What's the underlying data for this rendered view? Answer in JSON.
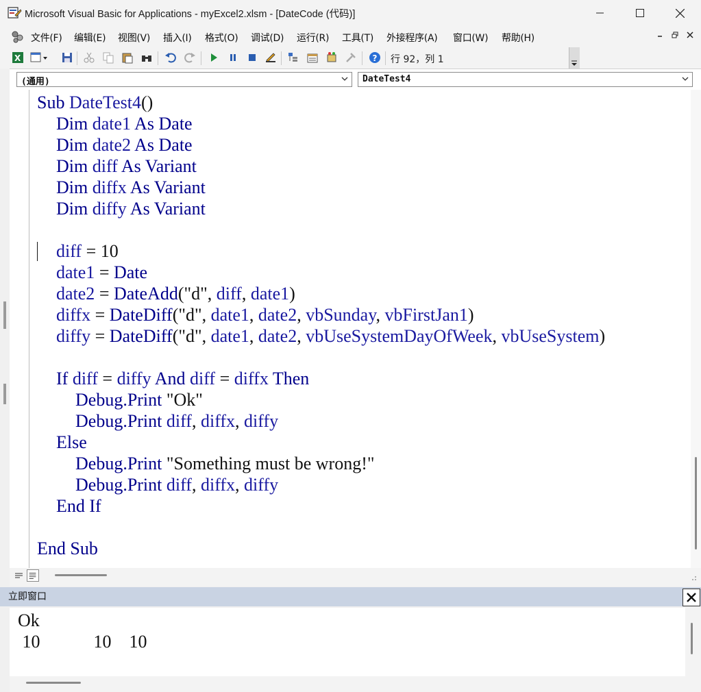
{
  "window": {
    "title": "Microsoft Visual Basic for Applications - myExcel2.xlsm - [DateCode (代码)]"
  },
  "menu": {
    "items": [
      {
        "label": "文件(F)"
      },
      {
        "label": "编辑(E)"
      },
      {
        "label": "视图(V)"
      },
      {
        "label": "插入(I)"
      },
      {
        "label": "格式(O)"
      },
      {
        "label": "调试(D)"
      },
      {
        "label": "运行(R)"
      },
      {
        "label": "工具(T)"
      },
      {
        "label": "外接程序(A)"
      },
      {
        "label": "窗口(W)"
      },
      {
        "label": "帮助(H)"
      }
    ]
  },
  "toolbar": {
    "cursor_position": "行 92，列 1",
    "icons": [
      "excel-icon",
      "insert-userform-icon",
      "save-icon",
      "cut-icon",
      "copy-icon",
      "paste-icon",
      "find-icon",
      "undo-icon",
      "redo-icon",
      "run-icon",
      "break-icon",
      "reset-icon",
      "design-mode-icon",
      "project-explorer-icon",
      "properties-icon",
      "object-browser-icon",
      "toolbox-icon",
      "help-icon"
    ]
  },
  "code_window": {
    "object_combo": "(通用)",
    "procedure_combo": "DateTest4",
    "lines": [
      {
        "indent": 0,
        "parts": [
          {
            "t": "Sub ",
            "c": "kw"
          },
          {
            "t": "DateTest4",
            "c": "id"
          },
          {
            "t": "()",
            "c": "tx"
          }
        ]
      },
      {
        "indent": 1,
        "parts": [
          {
            "t": "Dim ",
            "c": "kw"
          },
          {
            "t": "date1",
            "c": "id"
          },
          {
            "t": " As Date",
            "c": "kw"
          }
        ]
      },
      {
        "indent": 1,
        "parts": [
          {
            "t": "Dim ",
            "c": "kw"
          },
          {
            "t": "date2",
            "c": "id"
          },
          {
            "t": " As Date",
            "c": "kw"
          }
        ]
      },
      {
        "indent": 1,
        "parts": [
          {
            "t": "Dim ",
            "c": "kw"
          },
          {
            "t": "diff",
            "c": "id"
          },
          {
            "t": " As Variant",
            "c": "kw"
          }
        ]
      },
      {
        "indent": 1,
        "parts": [
          {
            "t": "Dim ",
            "c": "kw"
          },
          {
            "t": "diffx",
            "c": "id"
          },
          {
            "t": " As Variant",
            "c": "kw"
          }
        ]
      },
      {
        "indent": 1,
        "parts": [
          {
            "t": "Dim ",
            "c": "kw"
          },
          {
            "t": "diffy",
            "c": "id"
          },
          {
            "t": " As Variant",
            "c": "kw"
          }
        ]
      },
      {
        "indent": 0,
        "parts": []
      },
      {
        "indent": 1,
        "parts": [
          {
            "t": "diff",
            "c": "id"
          },
          {
            "t": " = 10",
            "c": "tx"
          }
        ]
      },
      {
        "indent": 1,
        "parts": [
          {
            "t": "date1",
            "c": "id"
          },
          {
            "t": " = ",
            "c": "tx"
          },
          {
            "t": "Date",
            "c": "kw"
          }
        ]
      },
      {
        "indent": 1,
        "parts": [
          {
            "t": "date2",
            "c": "id"
          },
          {
            "t": " = ",
            "c": "tx"
          },
          {
            "t": "DateAdd",
            "c": "kw"
          },
          {
            "t": "(\"d\", ",
            "c": "tx"
          },
          {
            "t": "diff",
            "c": "id"
          },
          {
            "t": ", ",
            "c": "tx"
          },
          {
            "t": "date1",
            "c": "id"
          },
          {
            "t": ")",
            "c": "tx"
          }
        ]
      },
      {
        "indent": 1,
        "parts": [
          {
            "t": "diffx",
            "c": "id"
          },
          {
            "t": " = ",
            "c": "tx"
          },
          {
            "t": "DateDiff",
            "c": "kw"
          },
          {
            "t": "(\"d\", ",
            "c": "tx"
          },
          {
            "t": "date1",
            "c": "id"
          },
          {
            "t": ", ",
            "c": "tx"
          },
          {
            "t": "date2",
            "c": "id"
          },
          {
            "t": ", ",
            "c": "tx"
          },
          {
            "t": "vbSunday",
            "c": "id"
          },
          {
            "t": ", ",
            "c": "tx"
          },
          {
            "t": "vbFirstJan1",
            "c": "id"
          },
          {
            "t": ")",
            "c": "tx"
          }
        ]
      },
      {
        "indent": 1,
        "parts": [
          {
            "t": "diffy",
            "c": "id"
          },
          {
            "t": " = ",
            "c": "tx"
          },
          {
            "t": "DateDiff",
            "c": "kw"
          },
          {
            "t": "(\"d\", ",
            "c": "tx"
          },
          {
            "t": "date1",
            "c": "id"
          },
          {
            "t": ", ",
            "c": "tx"
          },
          {
            "t": "date2",
            "c": "id"
          },
          {
            "t": ", ",
            "c": "tx"
          },
          {
            "t": "vbUseSystemDayOfWeek",
            "c": "id"
          },
          {
            "t": ", ",
            "c": "tx"
          },
          {
            "t": "vbUseSystem",
            "c": "id"
          },
          {
            "t": ")",
            "c": "tx"
          }
        ]
      },
      {
        "indent": 0,
        "parts": []
      },
      {
        "indent": 1,
        "parts": [
          {
            "t": "If ",
            "c": "kw"
          },
          {
            "t": "diff",
            "c": "id"
          },
          {
            "t": " = ",
            "c": "tx"
          },
          {
            "t": "diffy",
            "c": "id"
          },
          {
            "t": " And ",
            "c": "kw"
          },
          {
            "t": "diff",
            "c": "id"
          },
          {
            "t": " = ",
            "c": "tx"
          },
          {
            "t": "diffx",
            "c": "id"
          },
          {
            "t": " Then",
            "c": "kw"
          }
        ]
      },
      {
        "indent": 2,
        "parts": [
          {
            "t": "Debug.Print",
            "c": "kw"
          },
          {
            "t": " \"Ok\"",
            "c": "tx"
          }
        ]
      },
      {
        "indent": 2,
        "parts": [
          {
            "t": "Debug.Print",
            "c": "kw"
          },
          {
            "t": " ",
            "c": "tx"
          },
          {
            "t": "diff",
            "c": "id"
          },
          {
            "t": ", ",
            "c": "tx"
          },
          {
            "t": "diffx",
            "c": "id"
          },
          {
            "t": ", ",
            "c": "tx"
          },
          {
            "t": "diffy",
            "c": "id"
          }
        ]
      },
      {
        "indent": 1,
        "parts": [
          {
            "t": "Else",
            "c": "kw"
          }
        ]
      },
      {
        "indent": 2,
        "parts": [
          {
            "t": "Debug.Print",
            "c": "kw"
          },
          {
            "t": " \"Something must be wrong!\"",
            "c": "tx"
          }
        ]
      },
      {
        "indent": 2,
        "parts": [
          {
            "t": "Debug.Print",
            "c": "kw"
          },
          {
            "t": " ",
            "c": "tx"
          },
          {
            "t": "diff",
            "c": "id"
          },
          {
            "t": ", ",
            "c": "tx"
          },
          {
            "t": "diffx",
            "c": "id"
          },
          {
            "t": ", ",
            "c": "tx"
          },
          {
            "t": "diffy",
            "c": "id"
          }
        ]
      },
      {
        "indent": 1,
        "parts": [
          {
            "t": "End If",
            "c": "kw"
          }
        ]
      },
      {
        "indent": 0,
        "parts": []
      },
      {
        "indent": 0,
        "parts": [
          {
            "t": "End Sub",
            "c": "kw"
          }
        ]
      }
    ]
  },
  "immediate_window": {
    "title": "立即窗口",
    "output": [
      "Ok",
      " 10            10    10"
    ]
  },
  "colors": {
    "keyword": "#00008b",
    "identifier": "#1a1aa0",
    "text": "#111111",
    "immediate_header": "#c9d3e3"
  }
}
